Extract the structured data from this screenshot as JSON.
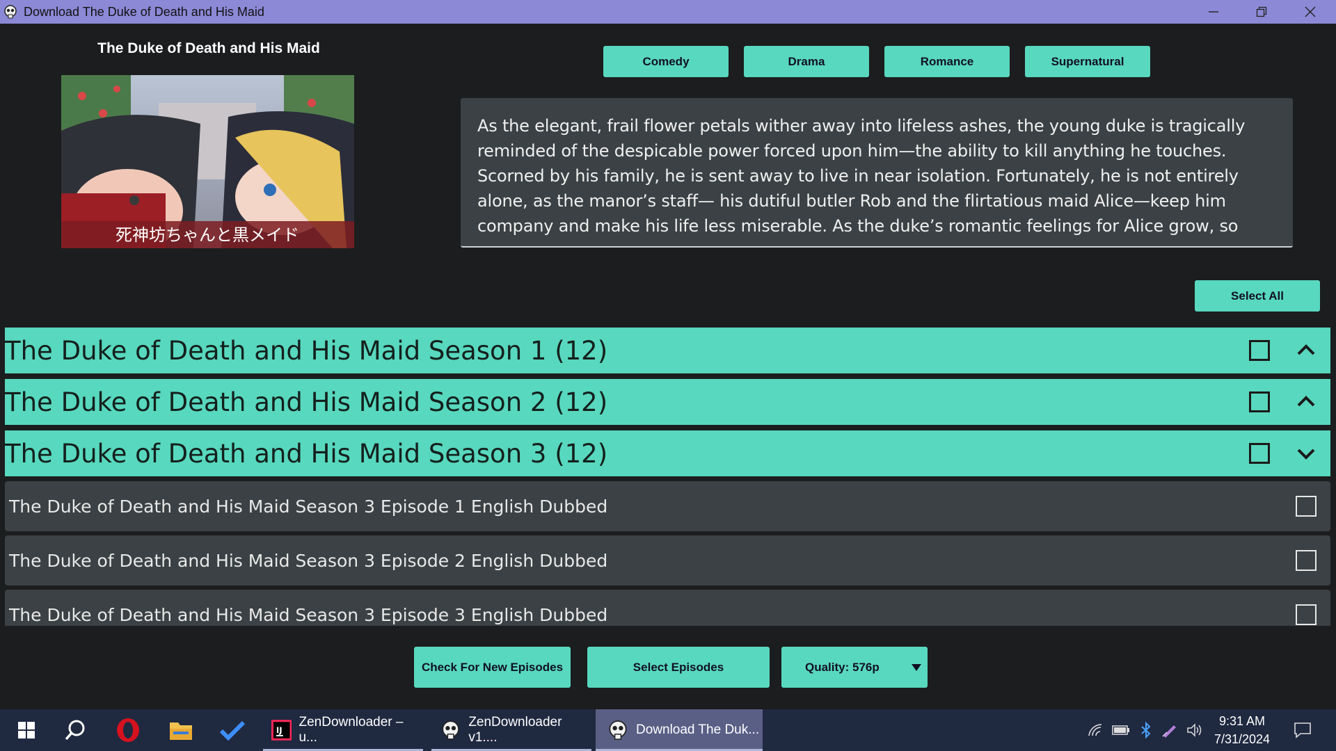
{
  "window": {
    "title": "Download The Duke of Death and His Maid",
    "controls": [
      "minimize-icon",
      "restore-icon",
      "close-icon"
    ]
  },
  "anime": {
    "title": "The Duke of Death and His Maid",
    "poster_caption": "死神坊ちゃんと黒メイド"
  },
  "genres": [
    "Comedy",
    "Drama",
    "Romance",
    "Supernatural"
  ],
  "synopsis": "As the elegant, frail flower petals wither away into lifeless ashes, the young duke is tragically reminded of the despicable power forced upon him—the ability to kill anything he touches. Scorned by his family, he is sent away to live in near isolation. Fortunately, he is not entirely alone, as the manor’s staff— his dutiful butler Rob and the flirtatious maid Alice—keep him company and make his life less miserable. As the duke’s romantic feelings for Alice grow, so does his continued frustration",
  "select_all_label": "Select All",
  "seasons": [
    {
      "label": "The Duke of Death and His Maid Season 1 (12)",
      "expanded": false,
      "checked": false,
      "chevron": "chevron-up-icon"
    },
    {
      "label": "The Duke of Death and His Maid Season 2 (12)",
      "expanded": false,
      "checked": false,
      "chevron": "chevron-up-icon"
    },
    {
      "label": "The Duke of Death and His Maid Season 3 (12)",
      "expanded": true,
      "checked": false,
      "chevron": "chevron-down-icon"
    }
  ],
  "episodes": [
    {
      "label": "The Duke of Death and His Maid Season 3 Episode 1 English Dubbed",
      "checked": false
    },
    {
      "label": "The Duke of Death and His Maid Season 3 Episode 2 English Dubbed",
      "checked": false
    },
    {
      "label": "The Duke of Death and His Maid Season 3 Episode 3 English Dubbed",
      "checked": false
    }
  ],
  "actions": {
    "check_new": "Check For New Episodes",
    "select_episodes": "Select Episodes",
    "quality": "Quality: 576p"
  },
  "taskbar": {
    "pinned": [
      "windows-start-icon",
      "search-icon",
      "opera-icon",
      "file-explorer-icon",
      "todo-icon"
    ],
    "apps": [
      {
        "label": "ZenDownloader – u...",
        "icon": "intellij-icon",
        "active": false
      },
      {
        "label": "ZenDownloader v1....",
        "icon": "skull-icon",
        "active": false
      },
      {
        "label": "Download The Duk...",
        "icon": "skull-icon",
        "active": true
      }
    ],
    "tray": [
      "network-icon",
      "battery-icon",
      "bluetooth-icon",
      "pen-icon",
      "volume-icon"
    ],
    "time": "9:31 AM",
    "date": "7/31/2024",
    "notification": "notification-icon"
  },
  "colors": {
    "accent": "#58d8be",
    "title_bar": "#8c89d6",
    "background": "#1b1d1e",
    "panel": "#3b4144",
    "taskbar": "#1f2940"
  }
}
